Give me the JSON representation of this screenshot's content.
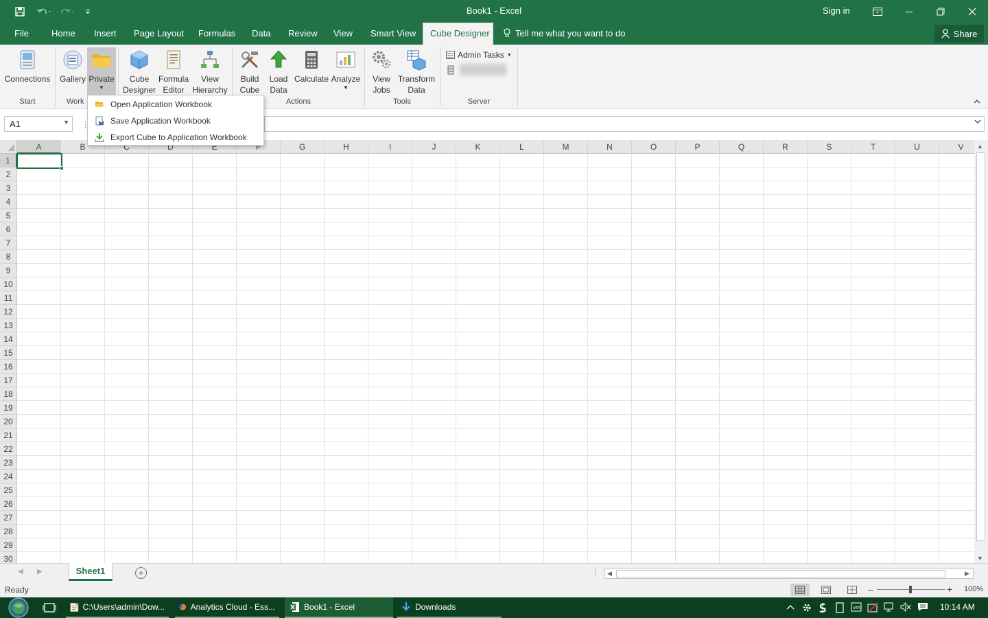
{
  "window": {
    "title": "Book1  -  Excel",
    "sign_in": "Sign in"
  },
  "tabs": [
    {
      "label": "File"
    },
    {
      "label": "Home"
    },
    {
      "label": "Insert"
    },
    {
      "label": "Page Layout"
    },
    {
      "label": "Formulas"
    },
    {
      "label": "Data"
    },
    {
      "label": "Review"
    },
    {
      "label": "View"
    },
    {
      "label": "Smart View"
    },
    {
      "label": "Cube Designer"
    }
  ],
  "tell_me": "Tell me what you want to do",
  "share_label": "Share",
  "ribbon": {
    "connections": "Connections",
    "gallery": "Gallery",
    "private": "Private",
    "cube_designer_1": "Cube",
    "cube_designer_2": "Designer",
    "formula_editor_1": "Formula",
    "formula_editor_2": "Editor",
    "view_hierarchy_1": "View",
    "view_hierarchy_2": "Hierarchy",
    "build_cube_1": "Build",
    "build_cube_2": "Cube",
    "load_data_1": "Load",
    "load_data_2": "Data",
    "calculate": "Calculate",
    "analyze": "Analyze",
    "view_jobs_1": "View",
    "view_jobs_2": "Jobs",
    "transform_data_1": "Transform",
    "transform_data_2": "Data",
    "admin_tasks": "Admin Tasks",
    "groups": {
      "start": "Start",
      "workbook": "Work",
      "actions": "Actions",
      "tools": "Tools",
      "server": "Server"
    }
  },
  "private_menu": {
    "items": [
      {
        "label": "Open Application Workbook"
      },
      {
        "label": "Save Application Workbook"
      },
      {
        "label": "Export Cube to Application Workbook"
      }
    ]
  },
  "formula_bar": {
    "name_box": "A1",
    "formula": ""
  },
  "grid": {
    "columns": [
      "A",
      "B",
      "C",
      "D",
      "E",
      "F",
      "G",
      "H",
      "I",
      "J",
      "K",
      "L",
      "M",
      "N",
      "O",
      "P",
      "Q",
      "R",
      "S",
      "T",
      "U",
      "V"
    ],
    "rows": [
      "1",
      "2",
      "3",
      "4",
      "5",
      "6",
      "7",
      "8",
      "9",
      "10",
      "11",
      "12",
      "13",
      "14",
      "15",
      "16",
      "17",
      "18",
      "19",
      "20",
      "21",
      "22",
      "23",
      "24",
      "25",
      "26",
      "27",
      "28",
      "29",
      "30"
    ],
    "selected_cell": "A1"
  },
  "sheets": [
    {
      "label": "Sheet1"
    }
  ],
  "status": {
    "ready": "Ready",
    "zoom": "100%"
  },
  "taskbar": {
    "items": [
      {
        "label": "C:\\Users\\admin\\Dow..."
      },
      {
        "label": "Analytics Cloud - Ess..."
      },
      {
        "label": "Book1 - Excel"
      },
      {
        "label": "Downloads"
      }
    ],
    "clock": "10:14 AM"
  },
  "colors": {
    "excel_green": "#217346",
    "taskbar": "#0c3f1f"
  }
}
